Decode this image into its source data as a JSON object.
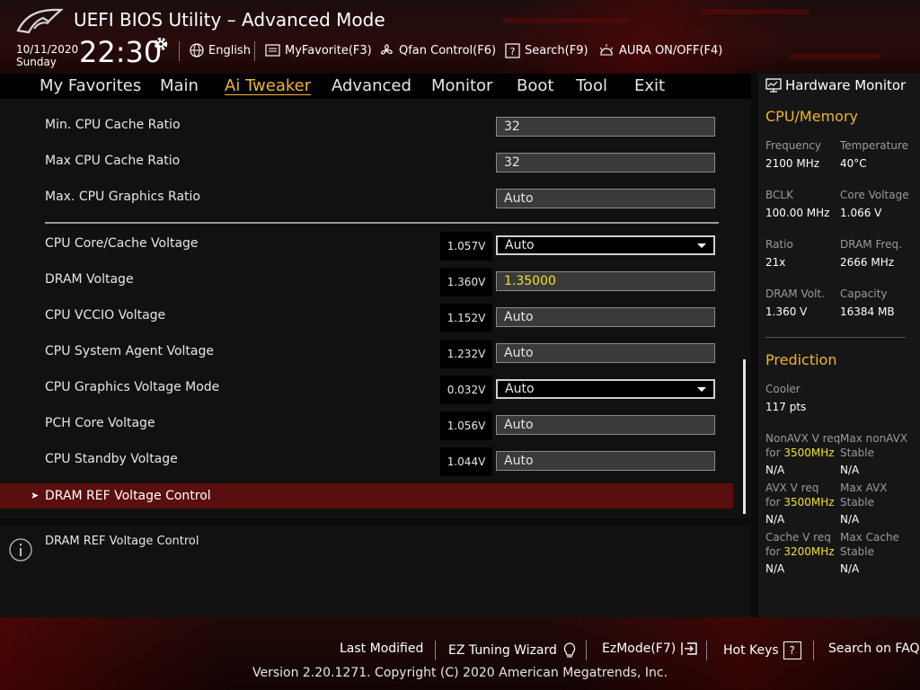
{
  "header": {
    "title": "UEFI BIOS Utility – Advanced Mode",
    "date": "10/11/2020",
    "day": "Sunday",
    "time": "22:30",
    "toolbar": {
      "language": "English",
      "myfavorite": "MyFavorite(F3)",
      "qfan": "Qfan Control(F6)",
      "search": "Search(F9)",
      "aura": "AURA ON/OFF(F4)"
    }
  },
  "menu": {
    "items": [
      "My Favorites",
      "Main",
      "Ai Tweaker",
      "Advanced",
      "Monitor",
      "Boot",
      "Tool",
      "Exit"
    ],
    "active": "Ai Tweaker"
  },
  "settings": [
    {
      "label": "Min. CPU Cache Ratio",
      "value": "32"
    },
    {
      "label": "Max CPU Cache Ratio",
      "value": "32"
    },
    {
      "label": "Max. CPU Graphics Ratio",
      "value": "Auto"
    },
    {
      "label": "CPU Core/Cache Voltage",
      "reading": "1.057V",
      "value": "Auto"
    },
    {
      "label": "DRAM Voltage",
      "reading": "1.360V",
      "value": "1.35000"
    },
    {
      "label": "CPU VCCIO Voltage",
      "reading": "1.152V",
      "value": "Auto"
    },
    {
      "label": "CPU System Agent Voltage",
      "reading": "1.232V",
      "value": "Auto"
    },
    {
      "label": "CPU Graphics Voltage Mode",
      "reading": "0.032V",
      "value": "Auto"
    },
    {
      "label": "PCH Core Voltage",
      "reading": "1.056V",
      "value": "Auto"
    },
    {
      "label": "CPU Standby Voltage",
      "reading": "1.044V",
      "value": "Auto"
    }
  ],
  "submenu": {
    "label": "DRAM REF Voltage Control",
    "arrow": "➤"
  },
  "help": {
    "text": "DRAM REF Voltage Control"
  },
  "hw_monitor": {
    "title": "Hardware Monitor",
    "cpu_memory": {
      "heading": "CPU/Memory",
      "frequency_label": "Frequency",
      "frequency": "2100 MHz",
      "temperature_label": "Temperature",
      "temperature": "40°C",
      "bclk_label": "BCLK",
      "bclk": "100.00 MHz",
      "core_voltage_label": "Core Voltage",
      "core_voltage": "1.066 V",
      "ratio_label": "Ratio",
      "ratio": "21x",
      "dram_freq_label": "DRAM Freq.",
      "dram_freq": "2666 MHz",
      "dram_volt_label": "DRAM Volt.",
      "dram_volt": "1.360 V",
      "capacity_label": "Capacity",
      "capacity": "16384 MB"
    },
    "prediction": {
      "heading": "Prediction",
      "cooler_label": "Cooler",
      "cooler": "117 pts",
      "nonavx_req_label": "NonAVX V req",
      "for_label": "for",
      "nonavx_freq": "3500MHz",
      "nonavx_req": "N/A",
      "max_nonavx_label": "Max nonAVX",
      "stable_label": "Stable",
      "max_nonavx": "N/A",
      "avx_req_label": "AVX V req",
      "avx_freq": "3500MHz",
      "avx_req": "N/A",
      "max_avx_label": "Max AVX",
      "max_avx": "N/A",
      "cache_req_label": "Cache V req",
      "cache_freq": "3200MHz",
      "cache_req": "N/A",
      "max_cache_label": "Max Cache",
      "max_cache": "N/A"
    }
  },
  "footer": {
    "last_modified": "Last Modified",
    "ez_tuning": "EZ Tuning Wizard",
    "ezmode": "EzMode(F7)",
    "hotkeys": "Hot Keys",
    "hotkeys_icon": "?",
    "faq": "Search on FAQ",
    "copyright": "Version 2.20.1271. Copyright (C) 2020 American Megatrends, Inc."
  },
  "colors": {
    "accent": "#f0b430",
    "highlight": "#f0e028",
    "submenu_bg": "#5a0e0e"
  }
}
